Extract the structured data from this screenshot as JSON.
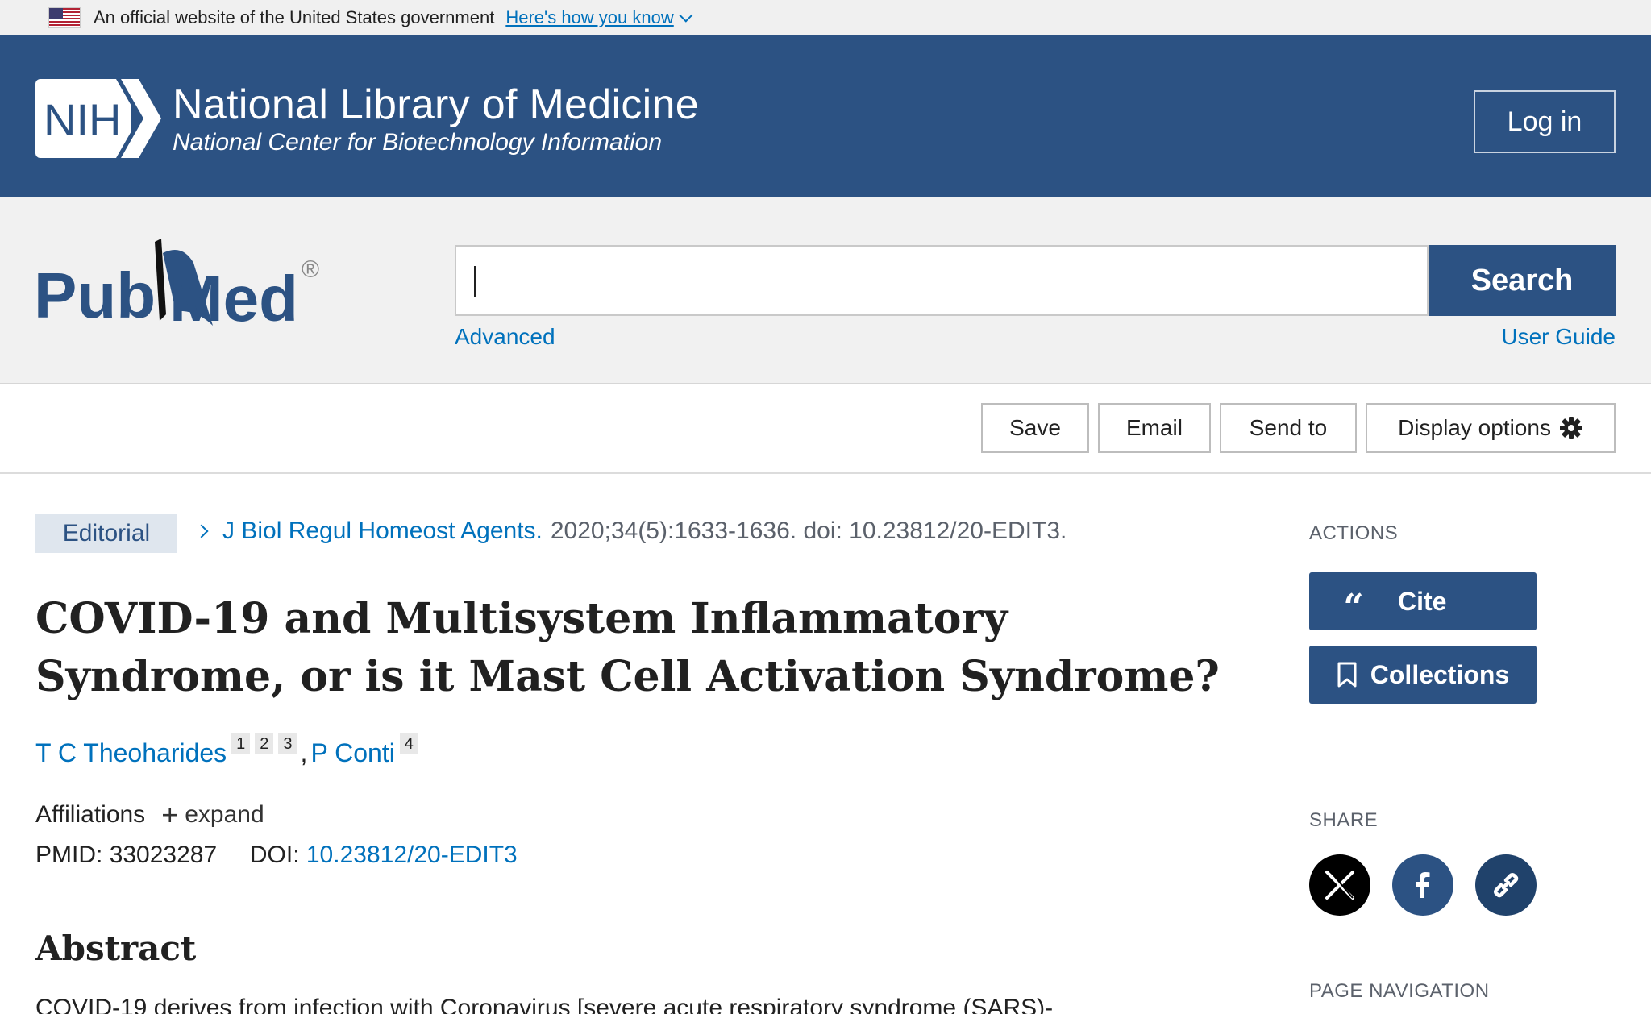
{
  "gov_banner": {
    "text": "An official website of the United States government",
    "link": "Here's how you know"
  },
  "nih_header": {
    "logo_text": "NIH",
    "title": "National Library of Medicine",
    "subtitle": "National Center for Biotechnology Information",
    "login": "Log in"
  },
  "search": {
    "logo_left": "Pub",
    "logo_right": "Med",
    "logo_mark": "®",
    "value": "",
    "button": "Search",
    "advanced": "Advanced",
    "user_guide": "User Guide"
  },
  "toolbar": {
    "save": "Save",
    "email": "Email",
    "send_to": "Send to",
    "display_options": "Display options"
  },
  "article": {
    "type": "Editorial",
    "journal": "J Biol Regul Homeost Agents.",
    "citation": "2020;34(5):1633-1636. doi: 10.23812/20-EDIT3.",
    "title": "COVID-19 and Multisystem Inflammatory Syndrome, or is it Mast Cell Activation Syndrome?",
    "authors": [
      {
        "name": "T C Theoharides",
        "affils": [
          "1",
          "2",
          "3"
        ]
      },
      {
        "name": "P Conti",
        "affils": [
          "4"
        ]
      }
    ],
    "author_sep": ",",
    "affiliations_label": "Affiliations",
    "expand_label": "expand",
    "pmid_label": "PMID:",
    "pmid": "33023287",
    "doi_label": "DOI:",
    "doi": "10.23812/20-EDIT3",
    "abstract_heading": "Abstract",
    "abstract_text": "COVID-19 derives from infection with Coronavirus [severe acute respiratory syndrome (SARS)-"
  },
  "sidebar": {
    "actions_label": "ACTIONS",
    "cite": "Cite",
    "cite_glyph": "“",
    "collections": "Collections",
    "share_label": "SHARE",
    "page_nav_label": "PAGE NAVIGATION"
  },
  "colors": {
    "nih_blue": "#2c5283",
    "link_blue": "#0071bc",
    "twitter": "#000000",
    "facebook": "#2c5283",
    "permalink": "#20426b"
  }
}
